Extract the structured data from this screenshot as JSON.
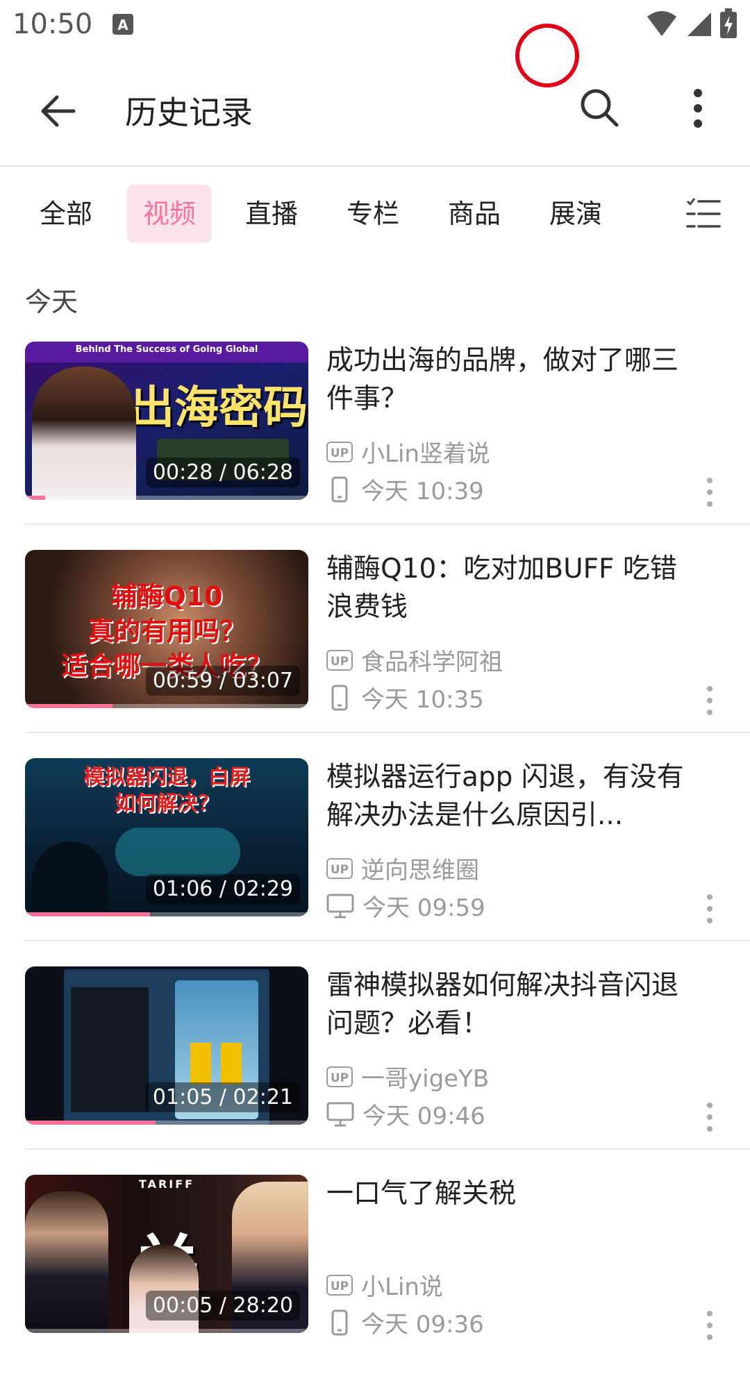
{
  "status_bar": {
    "time": "10:50"
  },
  "app_bar": {
    "title": "历史记录"
  },
  "tabs": [
    {
      "label": "全部"
    },
    {
      "label": "视频"
    },
    {
      "label": "直播"
    },
    {
      "label": "专栏"
    },
    {
      "label": "商品"
    },
    {
      "label": "展演"
    }
  ],
  "active_tab": "视频",
  "section": {
    "label": "今天"
  },
  "colors": {
    "accent": "#fb7299",
    "active_tab_bg": "#fde4ec",
    "meta_text": "#9a9a9a"
  },
  "items": [
    {
      "title": "成功出海的品牌，做对了哪三件事？",
      "uploader": "小Lin竖着说",
      "time": "今天 10:39",
      "device_icon": "phone-icon",
      "duration": "00:28 / 06:28",
      "progress": 0.07,
      "thumb_caption_top": "Behind The Success of Going Global",
      "thumb_caption_main": "出海密码"
    },
    {
      "title": "辅酶Q10：吃对加BUFF 吃错浪费钱",
      "uploader": "食品科学阿祖",
      "time": "今天 10:35",
      "device_icon": "phone-icon",
      "duration": "00:59 / 03:07",
      "progress": 0.31,
      "thumb_caption_line1": "辅酶Q10",
      "thumb_caption_line2": "真的有用吗？",
      "thumb_caption_line3": "适合哪一类人吃？"
    },
    {
      "title": "模拟器运行app 闪退，有没有解决办法是什么原因引...",
      "uploader": "逆向思维圈",
      "time": "今天 09:59",
      "device_icon": "monitor-icon",
      "duration": "01:06 / 02:29",
      "progress": 0.44,
      "thumb_caption_line1": "模拟器闪退，白屏",
      "thumb_caption_line2": "如何解决？"
    },
    {
      "title": "雷神模拟器如何解决抖音闪退问题？必看！",
      "uploader": "一哥yigeYB",
      "time": "今天 09:46",
      "device_icon": "monitor-icon",
      "duration": "01:05 / 02:21",
      "progress": 0.46
    },
    {
      "title": "一口气了解关税",
      "uploader": "小Lin说",
      "time": "今天 09:36",
      "device_icon": "phone-icon",
      "duration": "00:05 / 28:20",
      "progress": 0.01,
      "thumb_caption_top": "TARIFF",
      "thumb_caption_main": "关税"
    }
  ]
}
